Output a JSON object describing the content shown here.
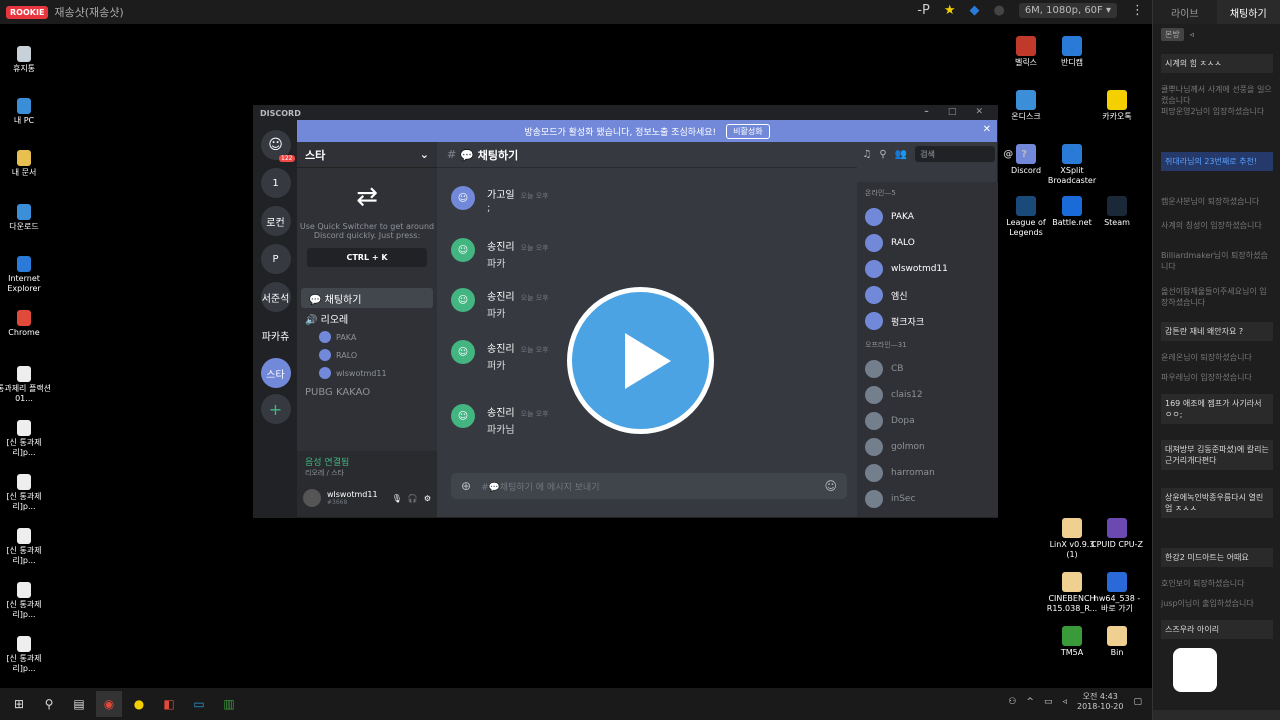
{
  "topbar": {
    "badge": "ROOKIE",
    "title": "재송샷(재송샷)",
    "quality": "6M, 1080p, 60F ▾"
  },
  "desktop_icons_left": [
    {
      "label": "휴지통",
      "color": "#c8d0d8"
    },
    {
      "label": "내 PC",
      "color": "#3a8fd8"
    },
    {
      "label": "내 문서",
      "color": "#e8c050"
    },
    {
      "label": "다운로드",
      "color": "#3a8fd8"
    },
    {
      "label": "Internet Explorer",
      "color": "#2a7ad8"
    },
    {
      "label": "Chrome",
      "color": "#e04a3a"
    },
    {
      "label": "통과제리 플랙션 01...",
      "color": "#eeeeee"
    },
    {
      "label": "[신 통과제리]p...",
      "color": "#eeeeee"
    },
    {
      "label": "[신 통과제리]p...",
      "color": "#eeeeee"
    },
    {
      "label": "[신 통과제리]p...",
      "color": "#eeeeee"
    },
    {
      "label": "[신 통과제리]p...",
      "color": "#eeeeee"
    },
    {
      "label": "[신 통과제리]p...",
      "color": "#eeeeee"
    }
  ],
  "desktop_icons_right": [
    {
      "label": "벨릭스",
      "color": "#c0392b"
    },
    {
      "label": "반디캠",
      "color": "#2a7ad8"
    },
    {
      "label": "온디스크",
      "color": "#3a8fd8"
    },
    {
      "label": "카카오톡",
      "color": "#f5d000"
    },
    {
      "label": "Discord",
      "color": "#7289da"
    },
    {
      "label": "XSplit Broadcaster",
      "color": "#2a7ad8"
    },
    {
      "label": "League of Legends",
      "color": "#1a4a7a"
    },
    {
      "label": "Battle.net",
      "color": "#1a6ad8"
    },
    {
      "label": "Steam",
      "color": "#1b2838"
    },
    {
      "label": "LinX v0.9.3 (1)",
      "color": "#f0d090"
    },
    {
      "label": "CPUID CPU-Z",
      "color": "#6a4ab0"
    },
    {
      "label": "CINEBENCH R15.038_R...",
      "color": "#f0d090"
    },
    {
      "label": "hw64_538 - 바로 가기",
      "color": "#2a6ad8"
    },
    {
      "label": "TM5A",
      "color": "#3a9a3a"
    },
    {
      "label": "Bin",
      "color": "#f0d090"
    }
  ],
  "discord": {
    "app_title": "DISCORD",
    "banner_text": "방송모드가 활성화 됐습니다, 정보노출 조심하세요!",
    "banner_button": "비활성화",
    "guilds": [
      {
        "label": "1"
      },
      {
        "label": "로컨"
      },
      {
        "label": "P"
      },
      {
        "label": "서준석"
      },
      {
        "label": "파카츄"
      },
      {
        "label": "스타"
      }
    ],
    "guild_badge": "122",
    "server_name": "스타",
    "quickswitch": {
      "line1": "Use Quick Switcher to get around",
      "line2": "Discord quickly. Just press:",
      "shortcut": "CTRL + K"
    },
    "channels": [
      {
        "label": "💬 채팅하기",
        "active": true
      },
      {
        "label": "🔊 리오레",
        "active": false
      }
    ],
    "voice_users": [
      {
        "name": "PAKA"
      },
      {
        "name": "RALO"
      },
      {
        "name": "wlswotmd11"
      }
    ],
    "more_channels": [
      {
        "label": "PUBG KAKAO"
      }
    ],
    "voice_status": "음성 연결됨",
    "voice_sub": "리오레 / 스타",
    "current_user": "wlswotmd11",
    "current_user_tag": "#3668",
    "chat_title": "💬 채팅하기",
    "search_placeholder": "검색",
    "messages": [
      {
        "name": "가고일",
        "time": "오늘 오후",
        "text": ";",
        "color": "blue"
      },
      {
        "name": "송진리",
        "time": "오늘 오후",
        "text": "파카",
        "color": "green"
      },
      {
        "name": "송진리",
        "time": "오늘 오후",
        "text": "파카",
        "color": "green"
      },
      {
        "name": "송진리",
        "time": "오늘 오후",
        "text": "퍼카",
        "color": "green"
      },
      {
        "name": "송진리",
        "time": "오늘 오후",
        "text": "파카님",
        "color": "green"
      }
    ],
    "composer_placeholder": "#💬채팅하기 에 메시지 보내기",
    "online_header": "온라인—5",
    "online": [
      {
        "name": "PAKA"
      },
      {
        "name": "RALO"
      },
      {
        "name": "wlswotmd11"
      },
      {
        "name": "엠신"
      },
      {
        "name": "펑크자크"
      }
    ],
    "offline_header": "오프라인—31",
    "offline": [
      {
        "name": "CB"
      },
      {
        "name": "clais12"
      },
      {
        "name": "Dopa"
      },
      {
        "name": "golmon"
      },
      {
        "name": "harroman"
      },
      {
        "name": "inSec"
      }
    ]
  },
  "taskbar": {
    "time": "오전 4:43",
    "date": "2018-10-20"
  },
  "sidebar": {
    "tabs": [
      {
        "label": "라이브"
      },
      {
        "label": "채팅하기"
      }
    ],
    "filter": "본방",
    "chats": [
      {
        "text": "시계의 힘 ㅈㅅㅅ",
        "style": "hi"
      },
      {
        "text": "쿨뿌나님께서 사계에 선풍을 일으켰습니다",
        "style": "dim"
      },
      {
        "text": "퍼망운영2님이 입장하셨습니다",
        "style": "dim"
      },
      {
        "text": "쥐대라님의 23번째로 추천!",
        "style": "blue"
      },
      {
        "text": "캠운샤분님이 퇴장하셨습니다",
        "style": "dim"
      },
      {
        "text": "사계의 칭성이 입장하셨습니다",
        "style": "dim"
      },
      {
        "text": "Billiardmaker님이 퇴장하셨습니다",
        "style": "dim"
      },
      {
        "text": "옮선이탐재울들이주세요님이 입장하셨습니다",
        "style": "dim"
      },
      {
        "text": "감튼란 재네 왜안자요 ?",
        "style": "hi"
      },
      {
        "text": "윤레온님이 퇴장하셨습니다",
        "style": "dim"
      },
      {
        "text": "파우레님이 입장하셨습니다",
        "style": "dim"
      },
      {
        "text": "169 애조에 젬프가 사기라서 ㅇㅇ;",
        "style": "hi"
      },
      {
        "text": "대져방부 김동준파셨)에 칼리는 근거리개다편다",
        "style": "hi"
      },
      {
        "text": "상윤에녹인박종우름다시 열린엄 ㅈㅅㅅ",
        "style": "hi"
      },
      {
        "text": "한강2 미드아트는 어때요",
        "style": "hi"
      },
      {
        "text": "호인보이 퇴장하셨습니다",
        "style": "dim"
      },
      {
        "text": "jusp이님이 출입하셨습니다",
        "style": "dim"
      },
      {
        "text": "스즈우라 아이리",
        "style": "hi"
      }
    ]
  }
}
